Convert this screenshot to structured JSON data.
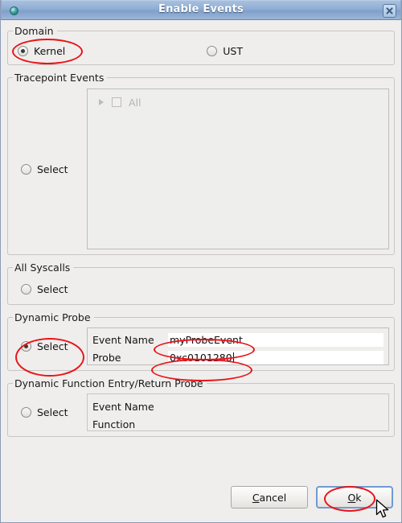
{
  "window": {
    "title": "Enable Events",
    "icon": "globe-icon",
    "close_icon": "close-icon"
  },
  "groups": {
    "domain": {
      "legend": "Domain",
      "options": [
        {
          "label": "Kernel",
          "checked": true
        },
        {
          "label": "UST",
          "checked": false
        }
      ]
    },
    "tracepoint_events": {
      "legend": "Tracepoint Events",
      "select_label": "Select",
      "select_checked": false,
      "tree": {
        "expander_icon": "chevron-right-icon",
        "checkbox_icon": "checkbox-unchecked-icon",
        "label": "All",
        "enabled": false
      }
    },
    "all_syscalls": {
      "legend": "All Syscalls",
      "select_label": "Select",
      "select_checked": false
    },
    "dynamic_probe": {
      "legend": "Dynamic Probe",
      "select_label": "Select",
      "select_checked": true,
      "fields": [
        {
          "label": "Event Name",
          "value": "myProbeEvent",
          "placeholder": ""
        },
        {
          "label": "Probe",
          "value": "0xc0101280",
          "placeholder": ""
        }
      ]
    },
    "dynamic_function_probe": {
      "legend": "Dynamic Function Entry/Return Probe",
      "select_label": "Select",
      "select_checked": false,
      "fields": [
        {
          "label": "Event Name",
          "value": "",
          "placeholder": ""
        },
        {
          "label": "Function",
          "value": "",
          "placeholder": ""
        }
      ]
    }
  },
  "buttons": {
    "cancel": {
      "pre": "",
      "mnemonic": "C",
      "post": "ancel"
    },
    "ok": {
      "pre": "",
      "mnemonic": "O",
      "post": "k"
    }
  },
  "annotations": {
    "color": "#e8141a",
    "targets": [
      "domain-kernel-radio",
      "dynamic-probe-select-radio",
      "event-name-value",
      "probe-value",
      "ok-button"
    ]
  }
}
